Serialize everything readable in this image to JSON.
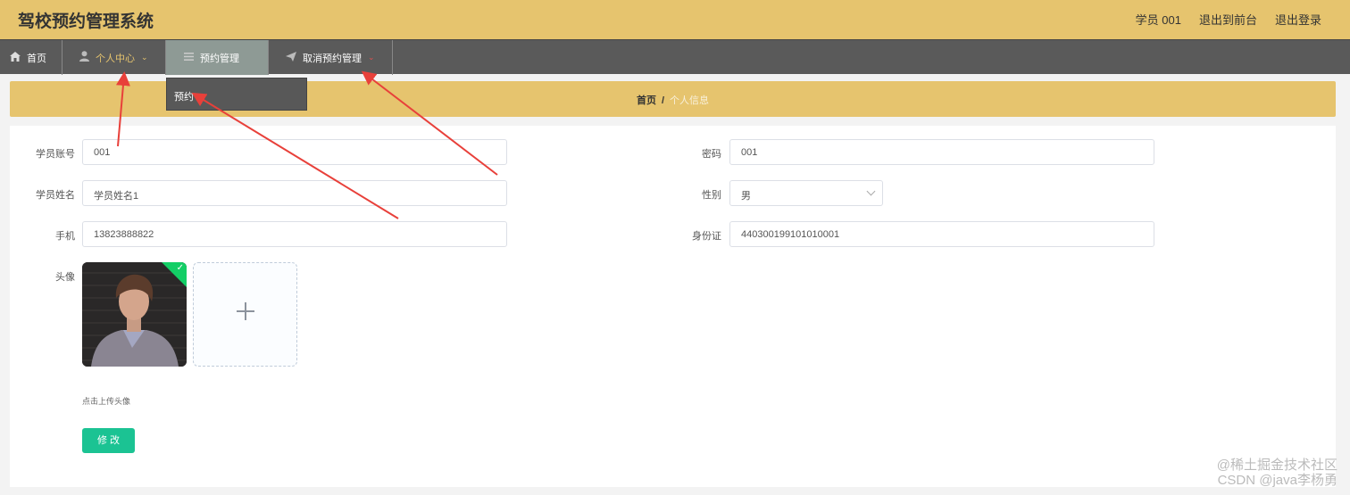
{
  "header": {
    "app_title": "驾校预约管理系统",
    "user_label": "学员 001",
    "to_front_label": "退出到前台",
    "logout_label": "退出登录"
  },
  "nav": {
    "items": [
      {
        "label": "首页",
        "icon": "home-icon"
      },
      {
        "label": "个人中心",
        "icon": "user-icon"
      },
      {
        "label": "预约管理",
        "icon": "list-icon"
      },
      {
        "label": "取消预约管理",
        "icon": "send-icon"
      }
    ],
    "dropdown_item": "预约"
  },
  "breadcrumb": {
    "home": "首页",
    "separator": "/",
    "current": "个人信息"
  },
  "form": {
    "account_label": "学员账号",
    "account_value": "001",
    "password_label": "密码",
    "password_value": "001",
    "name_label": "学员姓名",
    "name_value": "学员姓名1",
    "gender_label": "性别",
    "gender_value": "男",
    "phone_label": "手机",
    "phone_value": "13823888822",
    "idcard_label": "身份证",
    "idcard_value": "440300199101010001",
    "avatar_label": "头像",
    "upload_hint": "点击上传头像",
    "submit_label": "修 改"
  },
  "watermark": {
    "line1": "@稀土掘金技术社区",
    "line2": "CSDN @java李杨勇"
  },
  "colors": {
    "header_bg": "#e6c46e",
    "nav_bg": "#5a5a5a",
    "accent_green": "#1bc393",
    "arrow_red": "#e8403a"
  }
}
